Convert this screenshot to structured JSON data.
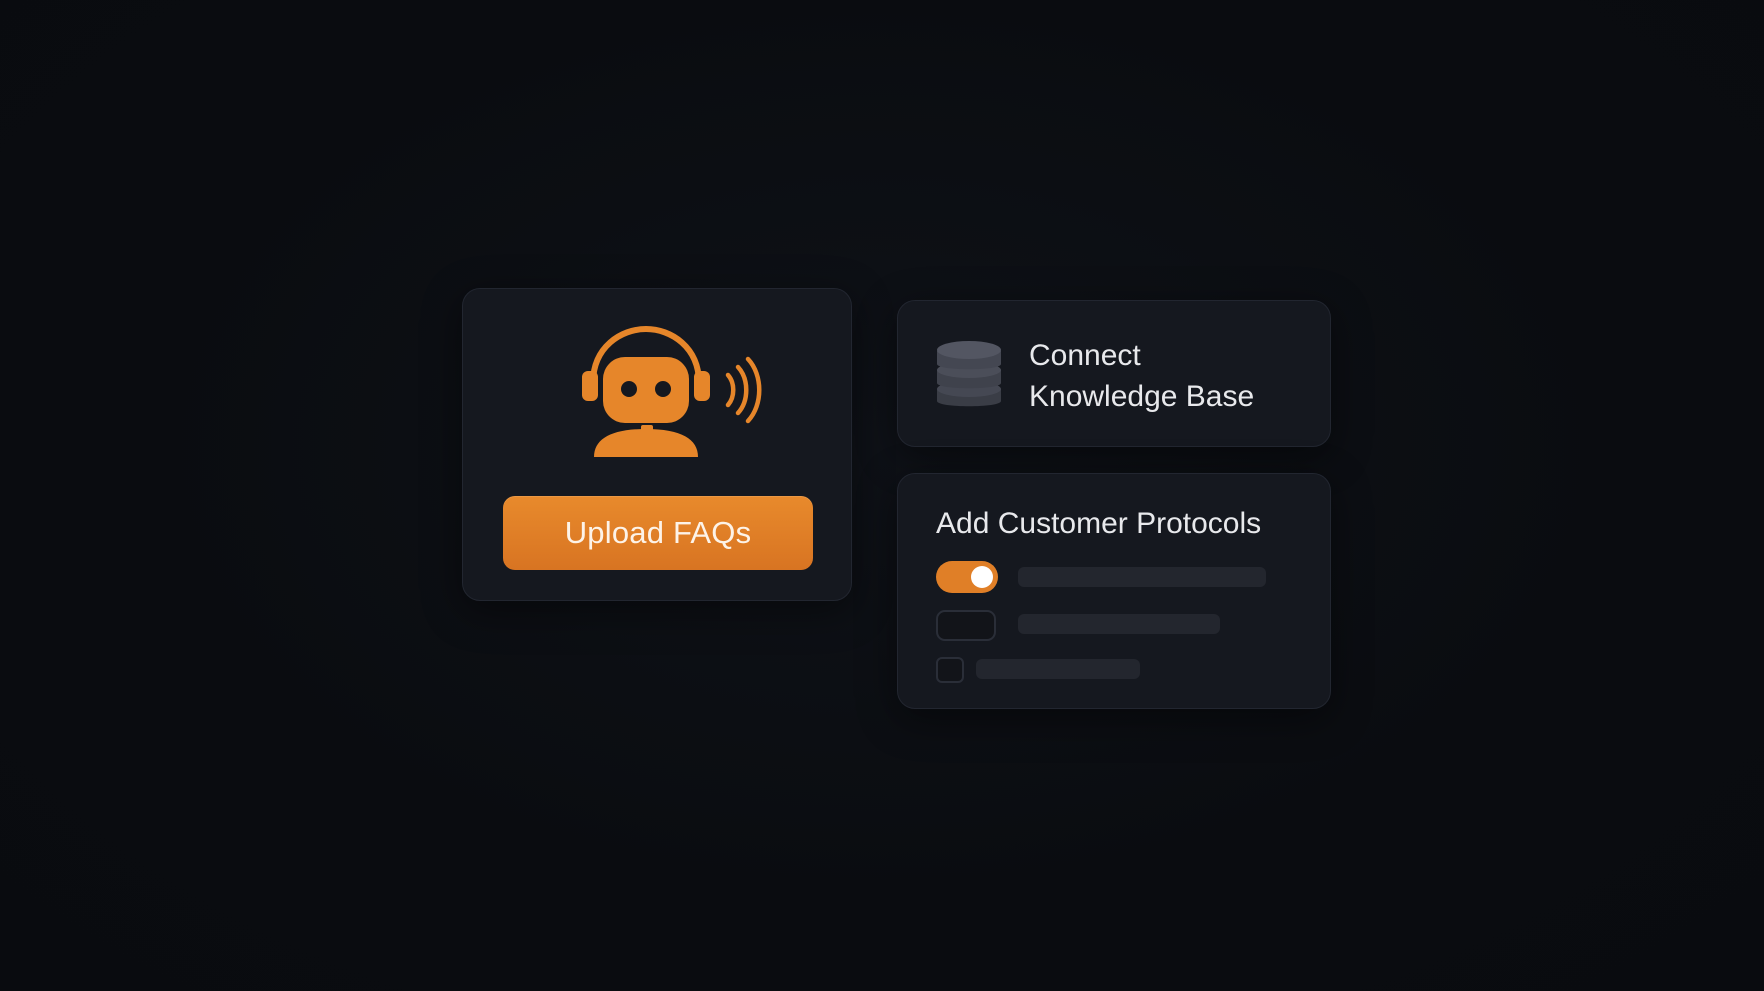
{
  "upload_card": {
    "icon": "support-bot-headset-icon",
    "button_label": "Upload FAQs"
  },
  "knowledge_card": {
    "icon": "database-icon",
    "title_line1": "Connect",
    "title_line2": "Knowledge Base"
  },
  "protocols_card": {
    "title": "Add Customer Protocols",
    "items": [
      {
        "control": "toggle",
        "state": "on"
      },
      {
        "control": "toggle",
        "state": "off"
      },
      {
        "control": "checkbox",
        "state": "unchecked"
      }
    ]
  },
  "colors": {
    "background": "#0a0c10",
    "card": "#15181f",
    "accent": "#e07f27",
    "text": "#e8e9ec",
    "placeholder_bar": "#23262e"
  }
}
